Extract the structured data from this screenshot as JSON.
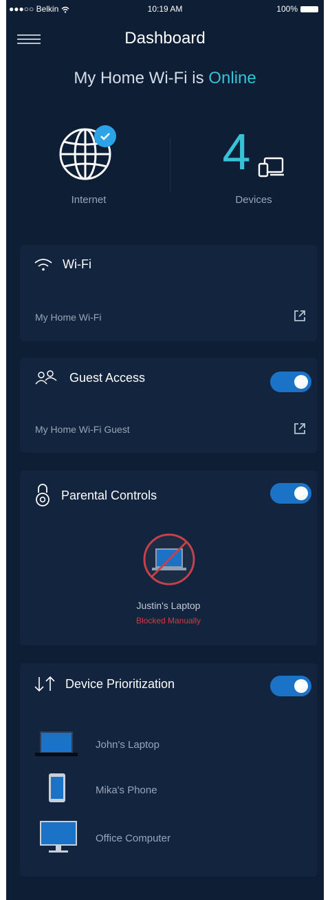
{
  "status_bar": {
    "carrier": "●●●○○ Belkin",
    "time": "10:19 AM",
    "battery": "100%"
  },
  "header": {
    "title": "Dashboard"
  },
  "network_status": {
    "prefix": "My Home Wi-Fi is ",
    "state": "Online"
  },
  "internet": {
    "label": "Internet",
    "connected": true
  },
  "devices": {
    "count": "4",
    "label": "Devices"
  },
  "wifi_card": {
    "title": "Wi-Fi",
    "network_name": "My Home Wi-Fi"
  },
  "guest_card": {
    "title": "Guest Access",
    "network_name": "My Home Wi-Fi Guest",
    "enabled": true
  },
  "parental_card": {
    "title": "Parental Controls",
    "enabled": true,
    "blocked_device": "Justin's Laptop",
    "blocked_status": "Blocked Manually"
  },
  "prioritization_card": {
    "title": "Device Prioritization",
    "enabled": true,
    "devices": [
      {
        "name": "John's Laptop",
        "icon": "laptop-icon"
      },
      {
        "name": "Mika's Phone",
        "icon": "phone-icon"
      },
      {
        "name": "Office Computer",
        "icon": "desktop-icon"
      }
    ]
  },
  "colors": {
    "background": "#0d1e35",
    "card": "#12243e",
    "accent": "#36c2d9",
    "toggle": "#1b73c7",
    "blocked": "#d13b45"
  }
}
